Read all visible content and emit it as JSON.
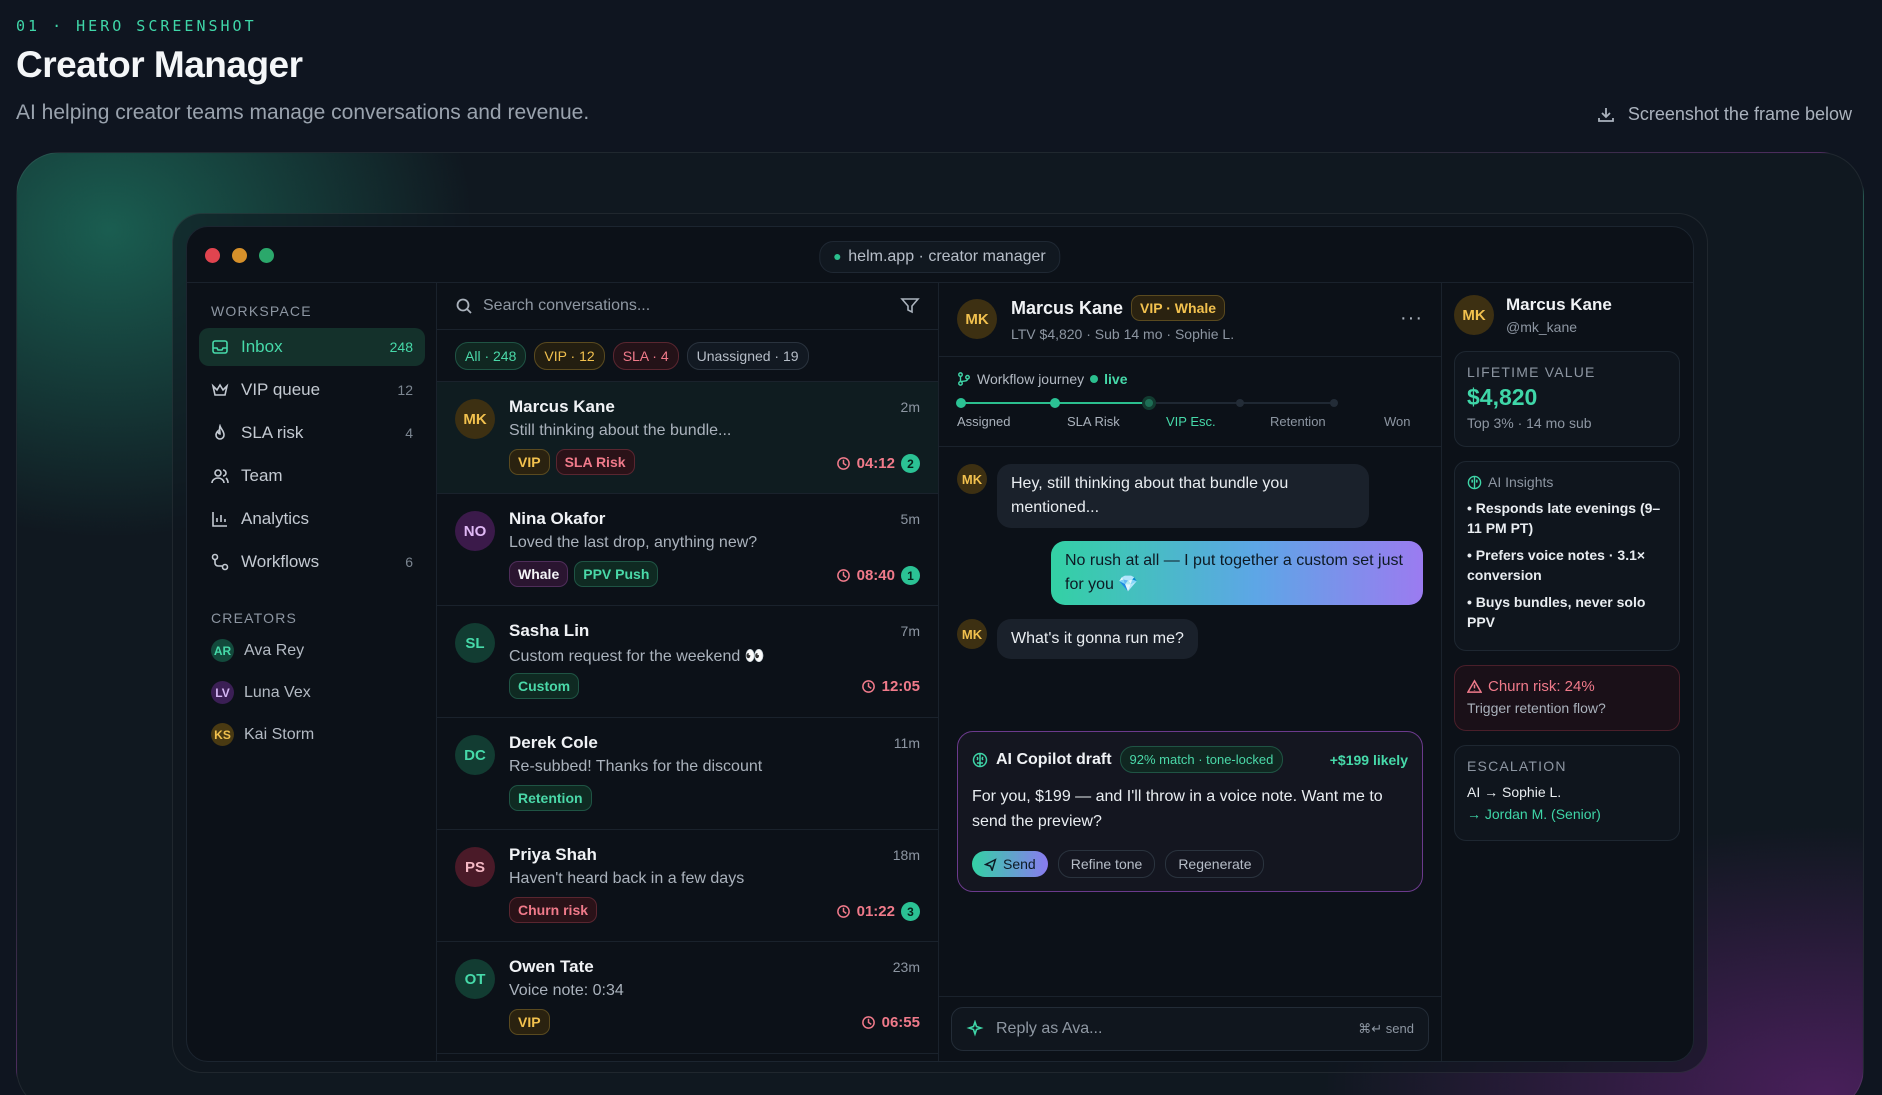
{
  "page": {
    "section_label": "01 · HERO SCREENSHOT",
    "title": "Creator Manager",
    "subtitle": "AI helping creator teams manage conversations and revenue.",
    "screenshot_hint": "Screenshot the frame below"
  },
  "window": {
    "url": "helm.app · creator manager"
  },
  "sidebar": {
    "workspace_heading": "WORKSPACE",
    "items": [
      {
        "label": "Inbox",
        "count": "248"
      },
      {
        "label": "VIP queue",
        "count": "12"
      },
      {
        "label": "SLA risk",
        "count": "4"
      },
      {
        "label": "Team",
        "count": ""
      },
      {
        "label": "Analytics",
        "count": ""
      },
      {
        "label": "Workflows",
        "count": "6"
      }
    ],
    "creators_heading": "CREATORS",
    "creators": [
      {
        "initials": "AR",
        "name": "Ava Rey"
      },
      {
        "initials": "LV",
        "name": "Luna Vex"
      },
      {
        "initials": "KS",
        "name": "Kai Storm"
      }
    ]
  },
  "list": {
    "search_placeholder": "Search conversations...",
    "filters": [
      "All · 248",
      "VIP · 12",
      "SLA · 4",
      "Unassigned · 19"
    ],
    "conversations": [
      {
        "initials": "MK",
        "name": "Marcus Kane",
        "time": "2m",
        "message": "Still thinking about the bundle...",
        "tags": [
          "VIP",
          "SLA Risk"
        ],
        "sla": "04:12",
        "unread": "2"
      },
      {
        "initials": "NO",
        "name": "Nina Okafor",
        "time": "5m",
        "message": "Loved the last drop, anything new?",
        "tags": [
          "Whale",
          "PPV Push"
        ],
        "sla": "08:40",
        "unread": "1"
      },
      {
        "initials": "SL",
        "name": "Sasha Lin",
        "time": "7m",
        "message": "Custom request for the weekend 👀",
        "tags": [
          "Custom"
        ],
        "sla": "12:05",
        "unread": ""
      },
      {
        "initials": "DC",
        "name": "Derek Cole",
        "time": "11m",
        "message": "Re-subbed! Thanks for the discount",
        "tags": [
          "Retention"
        ],
        "sla": "",
        "unread": ""
      },
      {
        "initials": "PS",
        "name": "Priya Shah",
        "time": "18m",
        "message": "Haven't heard back in a few days",
        "tags": [
          "Churn risk"
        ],
        "sla": "01:22",
        "unread": "3"
      },
      {
        "initials": "OT",
        "name": "Owen Tate",
        "time": "23m",
        "message": "Voice note: 0:34",
        "tags": [
          "VIP"
        ],
        "sla": "06:55",
        "unread": ""
      }
    ]
  },
  "chat": {
    "initials": "MK",
    "name": "Marcus Kane",
    "badge": "VIP · Whale",
    "meta": "LTV $4,820 · Sub 14 mo · Sophie L.",
    "journey_label": "Workflow journey",
    "journey_status": "live",
    "steps": [
      "Assigned",
      "SLA Risk",
      "VIP Esc.",
      "Retention",
      "Won"
    ],
    "messages": [
      {
        "from": "fan",
        "initials": "MK",
        "text": "Hey, still thinking about that bundle you mentioned..."
      },
      {
        "from": "creator",
        "text": "No rush at all — I put together a custom set just for you 💎"
      },
      {
        "from": "fan",
        "initials": "MK",
        "text": "What's it gonna run me?"
      }
    ],
    "copilot": {
      "title": "AI Copilot draft",
      "match": "92% match · tone-locked",
      "likely": "+$199 likely",
      "draft": "For you, $199 — and I'll throw in a voice note. Want me to send the preview?",
      "send": "Send",
      "refine": "Refine tone",
      "regenerate": "Regenerate"
    },
    "reply_placeholder": "Reply as Ava...",
    "send_hint": "⌘↵ send"
  },
  "profile": {
    "initials": "MK",
    "name": "Marcus Kane",
    "handle": "@mk_kane",
    "ltv_heading": "LIFETIME VALUE",
    "ltv_value": "$4,820",
    "ltv_note": "Top 3% · 14 mo sub",
    "insights_heading": "AI Insights",
    "insights": [
      "• Responds late evenings (9–11 PM PT)",
      "• Prefers voice notes · 3.1× conversion",
      "• Buys bundles, never solo PPV"
    ],
    "churn_title": "Churn risk: 24%",
    "churn_action": "Trigger retention flow?",
    "escalation_heading": "ESCALATION",
    "escalation_line1": "AI → Sophie L.",
    "escalation_line2": "→ Jordan M. (Senior)"
  },
  "colors": {
    "accent": "#3fd6a8",
    "vip": "#f2c14e",
    "risk": "#f07a8a",
    "copilot_border": "#6b3a8c"
  }
}
